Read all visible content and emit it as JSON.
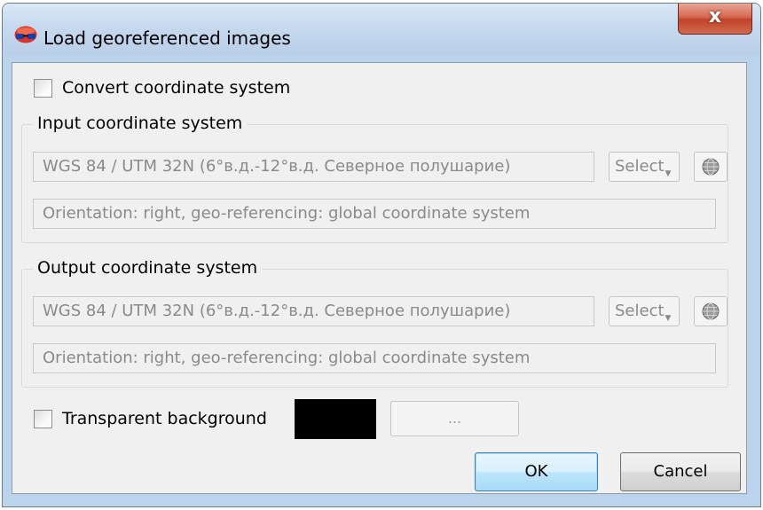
{
  "window": {
    "title": "Load georeferenced images",
    "close_label": "x"
  },
  "convert_checkbox": {
    "label": "Convert coordinate system",
    "checked": false
  },
  "input_group": {
    "title": "Input coordinate system",
    "system_value": "WGS 84 / UTM 32N (6°в.д.-12°в.д. Северное полушарие)",
    "select_label": "Select",
    "info_value": "Orientation: right, geo-referencing: global coordinate system"
  },
  "output_group": {
    "title": "Output coordinate system",
    "system_value": "WGS 84 / UTM 32N (6°в.д.-12°в.д. Северное полушарие)",
    "select_label": "Select",
    "info_value": "Orientation: right, geo-referencing: global coordinate system"
  },
  "transparent": {
    "label": "Transparent background",
    "checked": false,
    "swatch_color": "#000000",
    "dots_label": "..."
  },
  "buttons": {
    "ok": "OK",
    "cancel": "Cancel"
  },
  "icons": {
    "title": "app-logo-icon",
    "globe": "globe-icon",
    "dropdown": "dropdown-arrow-icon"
  }
}
